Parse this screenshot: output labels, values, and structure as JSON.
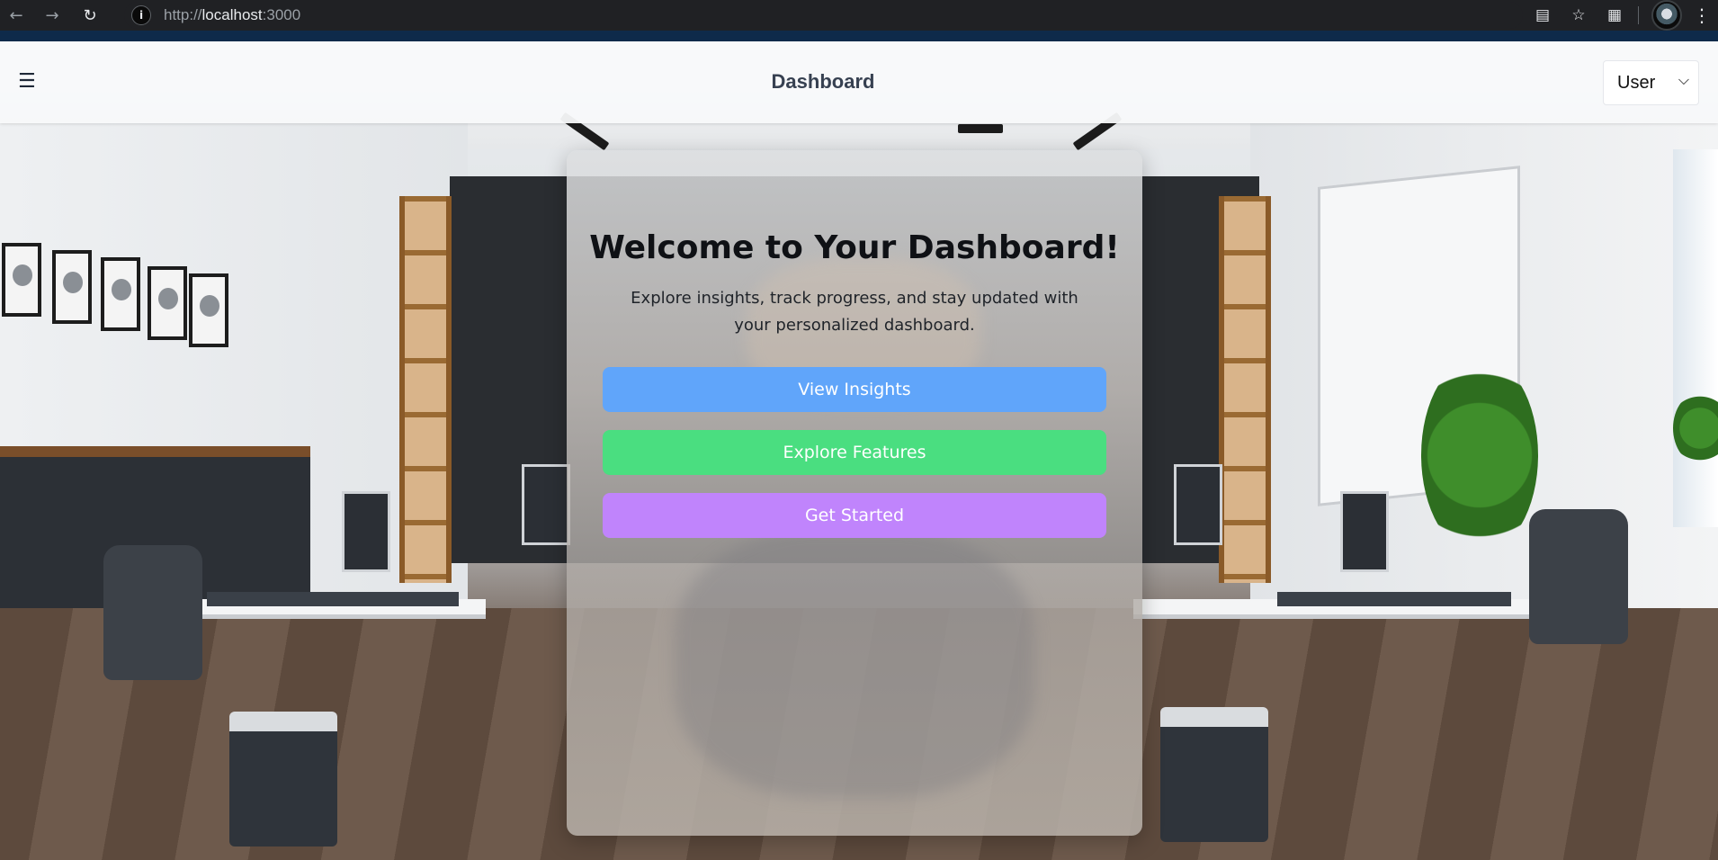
{
  "browser": {
    "url_scheme": "http://",
    "url_host": "localhost",
    "url_port": ":3000",
    "icons": [
      "back-arrow-icon",
      "forward-arrow-icon",
      "reload-icon",
      "site-info-icon",
      "install-app-icon",
      "bookmark-star-icon",
      "extensions-icon",
      "profile-avatar",
      "menu-kebab-icon"
    ]
  },
  "header": {
    "menu_icon": "☰",
    "title": "Dashboard",
    "user_select": {
      "selected": "User"
    }
  },
  "card": {
    "title": "Welcome to Your Dashboard!",
    "subtitle": "Explore insights, track progress, and stay updated with your personalized dashboard.",
    "buttons": [
      {
        "label": "View Insights",
        "color": "#60a5fa"
      },
      {
        "label": "Explore Features",
        "color": "#4ade80"
      },
      {
        "label": "Get Started",
        "color": "#c084fc"
      }
    ]
  }
}
